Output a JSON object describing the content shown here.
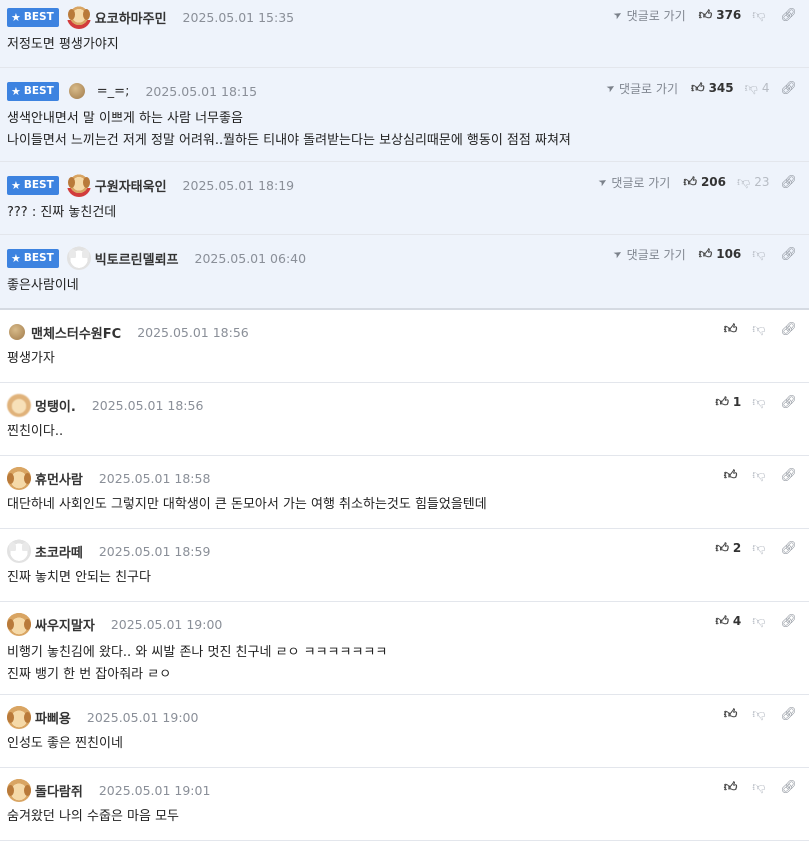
{
  "best_label": "BEST",
  "reply_label": "댓글로 가기",
  "comments": [
    {
      "best": true,
      "nick": "요코하마주민",
      "date": "2025.05.01 15:35",
      "up": "376",
      "down": "",
      "lines": [
        "저정도면 평생가야지"
      ]
    },
    {
      "best": true,
      "nick": "=_=;",
      "date": "2025.05.01 18:15",
      "up": "345",
      "down": "4",
      "lines": [
        "생색안내면서 말 이쁘게 하는 사람 너무좋음",
        "나이들면서 느끼는건 저게 정말 어려워..뭘하든 티내야 돌려받는다는 보상심리때문에 행동이 점점 짜쳐져"
      ]
    },
    {
      "best": true,
      "nick": "구원자태욱인",
      "date": "2025.05.01 18:19",
      "up": "206",
      "down": "23",
      "lines": [
        "??? : 진짜 놓친건데"
      ]
    },
    {
      "best": true,
      "nick": "빅토르린델뢰프",
      "date": "2025.05.01 06:40",
      "up": "106",
      "down": "",
      "lines": [
        "좋은사람이네"
      ]
    },
    {
      "best": false,
      "nick": "맨체스터수원FC",
      "date": "2025.05.01 18:56",
      "up": "",
      "down": "",
      "lines": [
        "평생가자"
      ]
    },
    {
      "best": false,
      "nick": "멍탱이.",
      "date": "2025.05.01 18:56",
      "up": "1",
      "down": "",
      "lines": [
        "찐친이다.."
      ]
    },
    {
      "best": false,
      "nick": "휴먼사람",
      "date": "2025.05.01 18:58",
      "up": "",
      "down": "",
      "lines": [
        "대단하네 사회인도 그렇지만 대학생이 큰 돈모아서 가는 여행 취소하는것도 힘들었을텐데"
      ]
    },
    {
      "best": false,
      "nick": "초코라떼",
      "date": "2025.05.01 18:59",
      "up": "2",
      "down": "",
      "lines": [
        "진짜 놓치면 안되는 친구다"
      ]
    },
    {
      "best": false,
      "nick": "싸우지말자",
      "date": "2025.05.01 19:00",
      "up": "4",
      "down": "",
      "lines": [
        "비행기 놓친김에 왔다.. 와 씨발 존나 멋진 친구네 ㄹㅇ ㅋㅋㅋㅋㅋㅋㅋ",
        "진짜 뱅기 한 번 잡아줘라 ㄹㅇ"
      ]
    },
    {
      "best": false,
      "nick": "파삐용",
      "date": "2025.05.01 19:00",
      "up": "",
      "down": "",
      "lines": [
        "인성도 좋은 찐친이네"
      ]
    },
    {
      "best": false,
      "nick": "돌다람쥐",
      "date": "2025.05.01 19:01",
      "up": "",
      "down": "",
      "lines": [
        "숨겨왔던 나의 수줍은 마음 모두"
      ]
    }
  ]
}
